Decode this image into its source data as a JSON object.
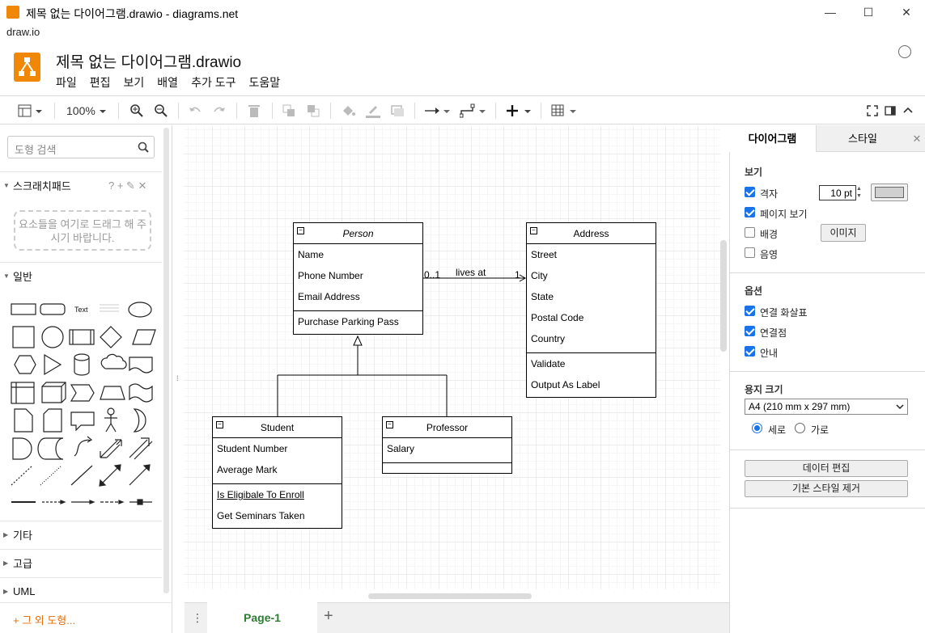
{
  "window": {
    "title": "제목 없는 다이어그램.drawio - diagrams.net",
    "app_menu": "draw.io",
    "controls": {
      "minimize": "—",
      "maximize": "☐",
      "close": "✕"
    }
  },
  "header": {
    "doc_title": "제목 없는 다이어그램.drawio",
    "menu": [
      "파일",
      "편집",
      "보기",
      "배열",
      "추가 도구",
      "도움말"
    ]
  },
  "toolbar": {
    "zoom": "100%"
  },
  "sidebar": {
    "search_placeholder": "도형 검색",
    "scratchpad_title": "스크래치패드",
    "scratchpad_icons": "? + ✎ ✕",
    "scratchpad_drop": "요소들을 여기로 드래그 해 주시기 바랍니다.",
    "general_title": "일반",
    "text_shape": "Text",
    "sections": [
      "기타",
      "고급",
      "UML"
    ],
    "more_shapes": "+ 그 외 도형..."
  },
  "diagram": {
    "edge_label": "lives at",
    "edge_src_mult": "0..1",
    "edge_tgt_mult": "1",
    "classes": {
      "person": {
        "name": "Person",
        "attrs": [
          "Name",
          "Phone Number",
          "Email Address"
        ],
        "ops": [
          "Purchase Parking Pass"
        ]
      },
      "address": {
        "name": "Address",
        "attrs": [
          "Street",
          "City",
          "State",
          "Postal Code",
          "Country"
        ],
        "ops": [
          "Validate",
          "Output As Label"
        ]
      },
      "student": {
        "name": "Student",
        "attrs": [
          "Student Number",
          "Average Mark"
        ],
        "ops": [
          "Is Eligibale To Enroll",
          "Get Seminars Taken"
        ]
      },
      "professor": {
        "name": "Professor",
        "attrs": [
          "Salary"
        ],
        "ops": []
      }
    }
  },
  "pages": {
    "active": "Page-1"
  },
  "format_panel": {
    "tabs": [
      "다이어그램",
      "스타일"
    ],
    "view": {
      "title": "보기",
      "grid_label": "격자",
      "grid_size": "10 pt",
      "page_view_label": "페이지 보기",
      "background_label": "배경",
      "image_button": "이미지",
      "shadow_label": "음영"
    },
    "options": {
      "title": "옵션",
      "connection_arrows": "연결 화살표",
      "connection_points": "연결점",
      "guides": "안내"
    },
    "paper": {
      "title": "용지 크기",
      "size": "A4 (210 mm x 297 mm)",
      "portrait": "세로",
      "landscape": "가로"
    },
    "buttons": {
      "edit_data": "데이터 편집",
      "clear_default_style": "기본 스타일 제거"
    }
  },
  "colors": {
    "accent": "#f08705",
    "page_tab": "#2e7d32",
    "checkbox": "#1a73e8"
  }
}
